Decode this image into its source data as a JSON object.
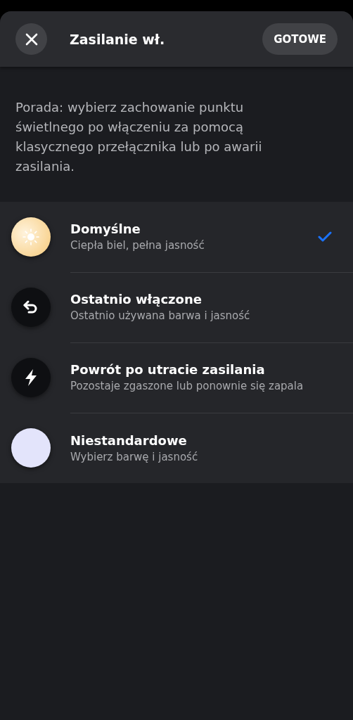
{
  "header": {
    "title": "Zasilanie wł.",
    "done_button": "GOTOWE"
  },
  "tip": "Porada: wybierz zachowanie punktu świetlnego po włączeniu za pomocą klasycznego przełącznika lub po awarii zasilania.",
  "options": [
    {
      "kind": "warm",
      "title": "Domyślne",
      "subtitle": "Ciepła biel, pełna jasność",
      "selected": true
    },
    {
      "kind": "last",
      "title": "Ostatnio włączone",
      "subtitle": "Ostatnio używana barwa i jasność",
      "selected": false
    },
    {
      "kind": "power",
      "title": "Powrót po utracie zasilania",
      "subtitle": "Pozostaje zgaszone lub ponownie się zapala",
      "selected": false
    },
    {
      "kind": "custom",
      "title": "Niestandardowe",
      "subtitle": "Wybierz barwę i jasność",
      "selected": false
    }
  ]
}
